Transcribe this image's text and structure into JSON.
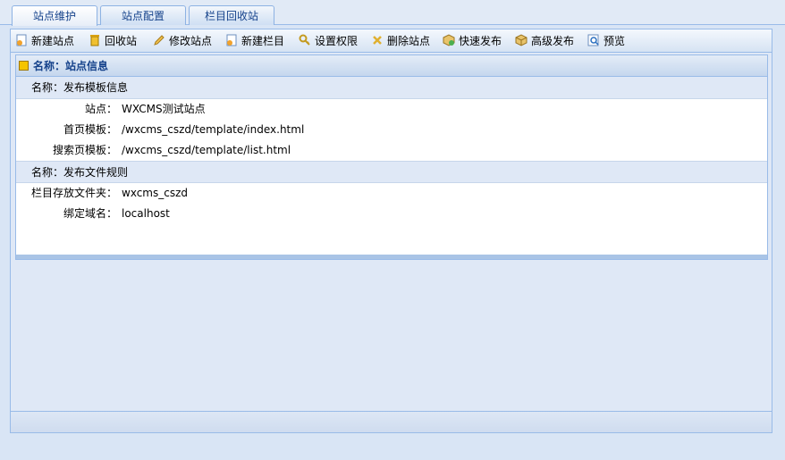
{
  "tabs": [
    {
      "label": "站点维护",
      "active": true
    },
    {
      "label": "站点配置",
      "active": false
    },
    {
      "label": "栏目回收站",
      "active": false
    }
  ],
  "toolbar": [
    {
      "label": "新建站点",
      "icon": "new-site-icon"
    },
    {
      "label": "回收站",
      "icon": "trash-icon"
    },
    {
      "label": "修改站点",
      "icon": "pencil-icon"
    },
    {
      "label": "新建栏目",
      "icon": "new-column-icon"
    },
    {
      "label": "设置权限",
      "icon": "key-icon"
    },
    {
      "label": "删除站点",
      "icon": "delete-icon"
    },
    {
      "label": "快速发布",
      "icon": "quick-publish-icon"
    },
    {
      "label": "高级发布",
      "icon": "advanced-publish-icon"
    },
    {
      "label": "预览",
      "icon": "preview-icon"
    }
  ],
  "panel": {
    "title": "名称：站点信息",
    "groups": [
      {
        "title": "名称：发布模板信息",
        "rows": [
          {
            "label": "站点：",
            "value": "WXCMS测试站点"
          },
          {
            "label": "首页模板：",
            "value": "/wxcms_cszd/template/index.html"
          },
          {
            "label": "搜索页模板：",
            "value": "/wxcms_cszd/template/list.html"
          }
        ]
      },
      {
        "title": "名称：发布文件规则",
        "rows": [
          {
            "label": "栏目存放文件夹：",
            "value": "wxcms_cszd"
          },
          {
            "label": "绑定域名：",
            "value": "localhost"
          }
        ]
      }
    ]
  },
  "colors": {
    "accent": "#15428b",
    "border": "#99bbe8",
    "header_bg": "#c5d7ee"
  }
}
